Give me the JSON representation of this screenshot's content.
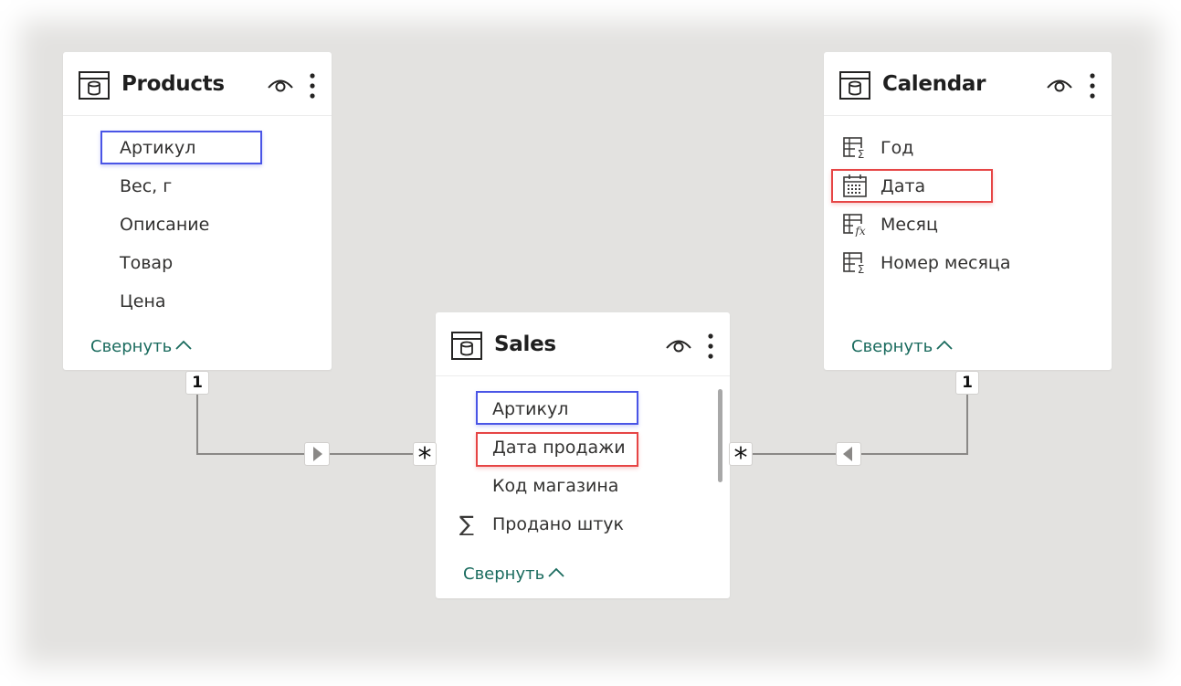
{
  "tables": {
    "products": {
      "title": "Products",
      "fields": [
        "Артикул",
        "Вес, г",
        "Описание",
        "Товар",
        "Цена"
      ],
      "collapse_label": "Свернуть"
    },
    "calendar": {
      "title": "Calendar",
      "fields": [
        "Год",
        "Дата",
        "Месяц",
        "Номер месяца"
      ],
      "collapse_label": "Свернуть"
    },
    "sales": {
      "title": "Sales",
      "fields": [
        "Артикул",
        "Дата продажи",
        "Код магазина",
        "Продано штук"
      ],
      "collapse_label": "Свернуть"
    }
  },
  "relationships": [
    {
      "from": "Products",
      "to": "Sales",
      "from_cardinality": "1",
      "to_cardinality": "*",
      "direction": "right"
    },
    {
      "from": "Calendar",
      "to": "Sales",
      "from_cardinality": "1",
      "to_cardinality": "*",
      "direction": "left"
    }
  ],
  "highlights": {
    "blue": "#4a55e6",
    "red": "#e64545"
  },
  "colors": {
    "link": "#1a6b5e",
    "canvas": "#e3e2e0"
  }
}
